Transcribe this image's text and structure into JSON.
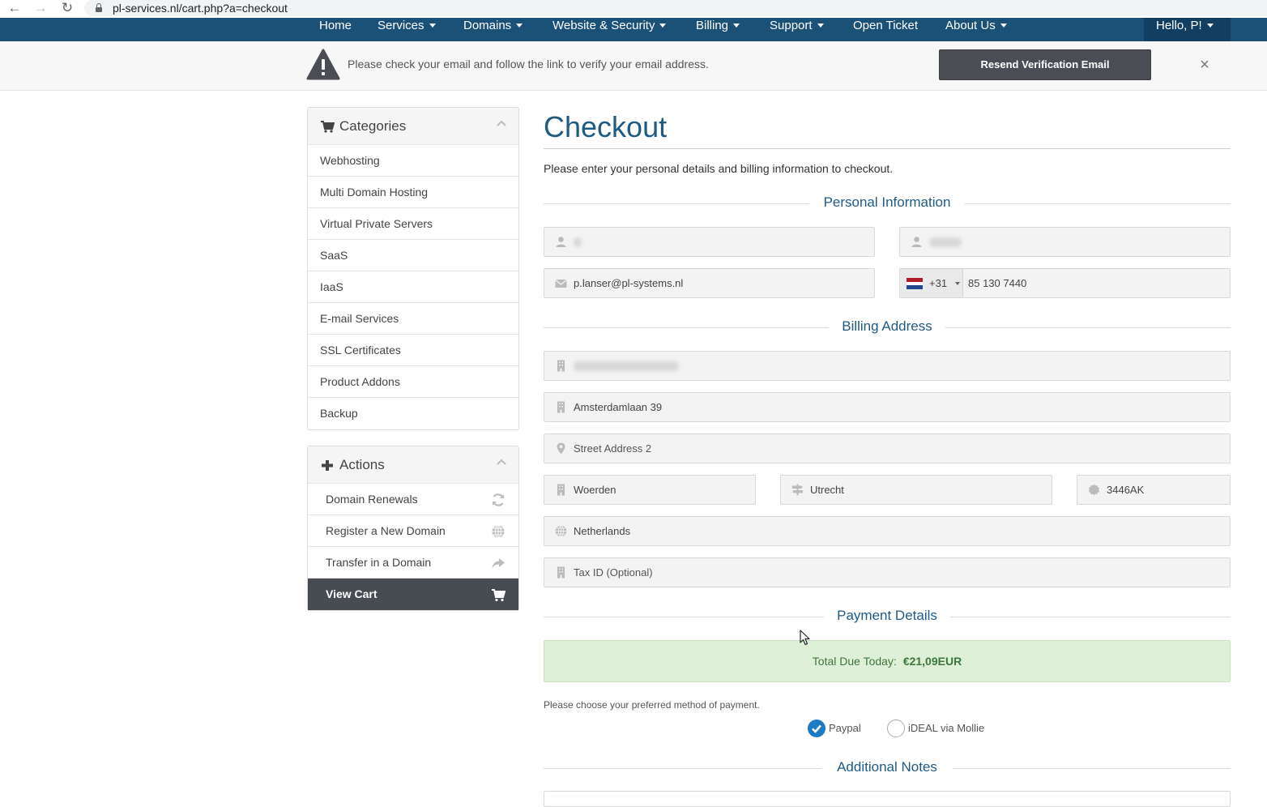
{
  "browser": {
    "url": "pl-services.nl/cart.php?a=checkout"
  },
  "nav": {
    "items": [
      {
        "label": "Home",
        "dropdown": false
      },
      {
        "label": "Services",
        "dropdown": true
      },
      {
        "label": "Domains",
        "dropdown": true
      },
      {
        "label": "Website & Security",
        "dropdown": true
      },
      {
        "label": "Billing",
        "dropdown": true
      },
      {
        "label": "Support",
        "dropdown": true
      },
      {
        "label": "Open Ticket",
        "dropdown": false
      },
      {
        "label": "About Us",
        "dropdown": true
      }
    ],
    "user_greeting": "Hello, P!"
  },
  "verify": {
    "message": "Please check your email and follow the link to verify your email address.",
    "resend_label": "Resend Verification Email",
    "close_label": "×"
  },
  "categories": {
    "title": "Categories",
    "items": [
      "Webhosting",
      "Multi Domain Hosting",
      "Virtual Private Servers",
      "SaaS",
      "IaaS",
      "E-mail Services",
      "SSL Certificates",
      "Product Addons",
      "Backup"
    ]
  },
  "actions": {
    "title": "Actions",
    "items": [
      {
        "label": "Domain Renewals",
        "icon": "refresh-icon"
      },
      {
        "label": "Register a New Domain",
        "icon": "globe-icon"
      },
      {
        "label": "Transfer in a Domain",
        "icon": "share-arrow-icon"
      },
      {
        "label": "View Cart",
        "icon": "cart-icon"
      }
    ]
  },
  "checkout": {
    "title": "Checkout",
    "intro": "Please enter your personal details and billing information to checkout.",
    "personal_heading": "Personal Information",
    "email": "p.lanser@pl-systems.nl",
    "phone_code": "+31",
    "phone": "85 130 7440",
    "billing_heading": "Billing Address",
    "address1": "Amsterdamlaan 39",
    "address2_placeholder": "Street Address 2",
    "city": "Woerden",
    "state": "Utrecht",
    "postcode": "3446AK",
    "country": "Netherlands",
    "taxid_placeholder": "Tax ID (Optional)",
    "payment_heading": "Payment Details",
    "total_label": "Total Due Today:",
    "total_value": "€21,09EUR",
    "payment_note": "Please choose your preferred method of payment.",
    "payment_methods": [
      "Paypal",
      "iDEAL via Mollie"
    ],
    "selected_payment": "Paypal",
    "notes_heading": "Additional Notes"
  },
  "colors": {
    "nav_bg": "#1c5177",
    "heading_blue": "#1f5a85",
    "success_bg": "#dff0d8",
    "dark_button": "#4a4d54",
    "radio_selected": "#1f7ac4"
  }
}
